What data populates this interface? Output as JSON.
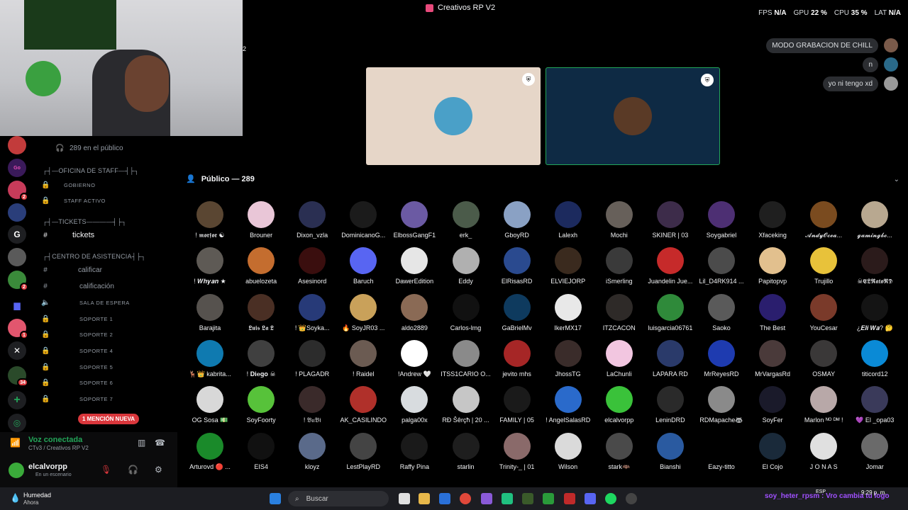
{
  "titlebar": {
    "app_title": "Creativos RP V2",
    "fps_label": "FPS",
    "fps": "N/A",
    "gpu_label": "GPU",
    "gpu": "22 %",
    "cpu_label": "CPU",
    "cpu": "35 %",
    "lat_label": "LAT",
    "lat": "N/A"
  },
  "sidebar": {
    "public_count": "289 en el público",
    "cat_staff": "┌┤—OFICINA DE STAFF—┤├┐",
    "gobierno": "GOBIERNO",
    "staff_activo": "STAFF ACTIVO",
    "cat_tickets": "┌┤—TICKETS————┤├┐",
    "tickets": "tickets",
    "cat_centro": "┌┤CENTRO DE ASISTENCIA┤├┐",
    "calificar": "calificar",
    "calificacion": "calificación",
    "sala": "SALA DE ESPERA",
    "soporte1": "SOPORTE 1",
    "soporte2": "SOPORTE 2",
    "soporte4": "SOPORTE 4",
    "soporte5": "SOPORTE 5",
    "soporte6": "SOPORTE 6",
    "soporte7": "SOPORTE 7",
    "mention": "1 MENCIÓN NUEVA"
  },
  "servers": [
    {
      "badge": "2"
    },
    {
      "badge": "2"
    },
    {
      "badge": "1"
    },
    {
      "badge": "34"
    }
  ],
  "voice": {
    "status": "Voz conectada",
    "channel": "CTv3 / Creativos RP V2",
    "user": "elcalvorpp",
    "user_status": "En un escenario"
  },
  "main": {
    "stray_num": "2",
    "chat1": "MODO GRABACION DE CHILL",
    "chat2": "n",
    "chat3": "yo ni tengo xd",
    "public_header": "Público — 289",
    "users": [
      "! 𝖒𝖔𝖗𝖋𝖔𝖗 ☯",
      "Brouner",
      "Dixon_vzla",
      "DominicanoG...",
      "ElbossGangF1",
      "erk_",
      "GboyRD",
      "Lalexh",
      "Mochi",
      "SKINER | 03",
      "Soygabriel",
      "Xfaceking",
      "𝓐𝓷𝓭𝔂𝓞𝓬𝓮𝓪...",
      "𝓰𝓪𝓶𝓲𝓷𝓰𝓫𝓸...",
      "! 𝑾𝒉𝒚𝒂𝒏 ★",
      "abuelozeta",
      "Asesinord",
      "Baruch",
      "DawerEdition",
      "Eddy",
      "ElRisasRD",
      "ELVIEJORP",
      "iSmerling",
      "Juandelin Jue...",
      "Lil_D4RK914 ...",
      "Papitopvp",
      "Trujillo",
      "☠𝕰𝕷𝕽𝖆𝖙𝖔𝕽𝕯",
      "Barajita",
      "𝕷𝖚𝖎𝖘 𝕷𝖆 𝕷",
      "! 👑Soyka...",
      "🔥 SoyJR03 ...",
      "aldo2889",
      "Carlos-lmg",
      "GaBrielMv",
      "IkerMX17",
      "ITZCACON",
      "luisgarcia06761",
      "Saoko",
      "The Best",
      "YouCesar",
      "¿𝑬𝒍𝒊 𝑾𝒂? 🤔",
      "🦌👑 kabrita...",
      "! 𝐃𝐢𝐞𝐠𝐨 ☠",
      "! PLAGADR",
      "! Raidel",
      "!Andrew 🤍",
      "ITSS1CARIO O...",
      "jevito mhs",
      "JhossTG",
      "LaChunli",
      "LAPARA RD",
      "MrReyesRD",
      "MrVargasRd",
      "OSMAY",
      "titicord12",
      "OG Sosa 💵",
      "SoyFoorty",
      "! 𝔅𝔲𝔅𝔦",
      "AK_CASILINDO",
      "palga00x",
      "RĐ Šêrçħ | 20 ...",
      "FAMILY | 05",
      "! AngelSalasRD",
      "elcalvorpp",
      "LeninDRD",
      "RDMapache🦝",
      "SoyFer",
      "Marlon ᴺᴼ ᴰᴹ !",
      "💜 El _opa03",
      "Arturovd 🔴 ...",
      "EIS4",
      "kloyz",
      "LestPlayRD",
      "Raffy Pina",
      "starlin",
      "Trinity-_ | 01",
      "Wilson",
      "stark🦇",
      "Bianshi",
      "Eazy-titto",
      "El Cojo",
      "J O N A S",
      "Jomar"
    ],
    "avatar_colors": [
      "#5a4632",
      "#e9c6d7",
      "#2a2f52",
      "#1b1b1b",
      "#6b5aa3",
      "#4b5b4a",
      "#8aa1c4",
      "#1c2a5e",
      "#67605a",
      "#3d2c4a",
      "#4d2f73",
      "#1f1f1f",
      "#7a4b1f",
      "#b8a890",
      "#5e5a55",
      "#c46d2f",
      "#3a0e0e",
      "#5865f2",
      "#e6e6e6",
      "#b0b0b0",
      "#2a4a8f",
      "#3a2a1e",
      "#3a3a3a",
      "#c62a2a",
      "#4b4b4b",
      "#e2c08e",
      "#e8c23a",
      "#2b1b1b",
      "#56524e",
      "#4a2f24",
      "#273a78",
      "#c9a15a",
      "#8a6a55",
      "#111111",
      "#0e3a5e",
      "#e8e8e8",
      "#2e2a28",
      "#2f8a3a",
      "#5a5a5a",
      "#2a1e6e",
      "#7a3a2a",
      "#141414",
      "#0f7ab0",
      "#404040",
      "#2c2c2c",
      "#6b5b52",
      "#ffffff",
      "#8a8a8a",
      "#a62626",
      "#3a2c2a",
      "#f2c6e0",
      "#2a3a6a",
      "#1e3bb0",
      "#4a3a3a",
      "#3a3838",
      "#0a8ad6",
      "#d8d8d8",
      "#57c23a",
      "#3a2a2a",
      "#b0302a",
      "#d8dcdf",
      "#c6c6c6",
      "#1a1a1a",
      "#2a6acb",
      "#3ac23a",
      "#2a2a2a",
      "#8a8a8a",
      "#1a1a2a",
      "#b8a8a8",
      "#3a3a5a",
      "#1a8a2a",
      "#111111",
      "#5a6a8a",
      "#444444",
      "#1a1a1a",
      "#1e1e1e",
      "#8a6a6a",
      "#dadada",
      "#4a4a4a",
      "#2a5aa0",
      "#000000",
      "#1a2a3a",
      "#e0e0e0",
      "#6a6a6a"
    ]
  },
  "taskbar": {
    "weather_title": "Humedad",
    "weather_sub": "Ahora",
    "search": "Buscar",
    "ticker": "soy_heter_rpsm : Vro cambia tu logo",
    "lang": "ESP",
    "time": "9:29 p. m."
  }
}
